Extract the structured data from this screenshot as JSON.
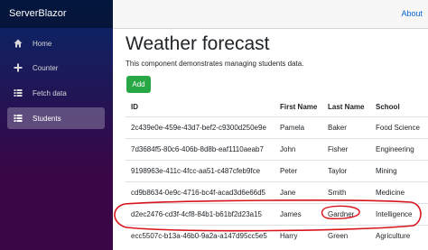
{
  "brand": "ServerBlazor",
  "top_link": "About",
  "nav": [
    {
      "label": "Home",
      "icon": "home-icon"
    },
    {
      "label": "Counter",
      "icon": "plus-icon"
    },
    {
      "label": "Fetch data",
      "icon": "list-icon"
    },
    {
      "label": "Students",
      "icon": "list-icon"
    }
  ],
  "page": {
    "title": "Weather forecast",
    "description": "This component demonstrates managing students data.",
    "add_label": "Add"
  },
  "table": {
    "headers": [
      "ID",
      "First Name",
      "Last Name",
      "School"
    ],
    "rows": [
      [
        "2c439e0e-459e-43d7-bef2-c9300d250e9e",
        "Pamela",
        "Baker",
        "Food Science"
      ],
      [
        "7d3684f5-80c6-406b-8d8b-eaf1110aeab7",
        "John",
        "Fisher",
        "Engineering"
      ],
      [
        "9198963e-411c-4fcc-aa51-c487cfeb9fce",
        "Peter",
        "Taylor",
        "Mining"
      ],
      [
        "cd9b8634-0e9c-4716-bc4f-acad3d6e66d5",
        "Jane",
        "Smith",
        "Medicine"
      ],
      [
        "d2ec2476-cd3f-4cf8-84b1-b61bf2d23a15",
        "James",
        "Gardner",
        "Intelligence"
      ],
      [
        "ecc5507c-b13a-46b0-9a2a-a147d95cc5e5",
        "Harry",
        "Green",
        "Agriculture"
      ]
    ]
  },
  "colors": {
    "accent": "#28a745",
    "link": "#0366d6",
    "annotation": "#d8141c"
  }
}
